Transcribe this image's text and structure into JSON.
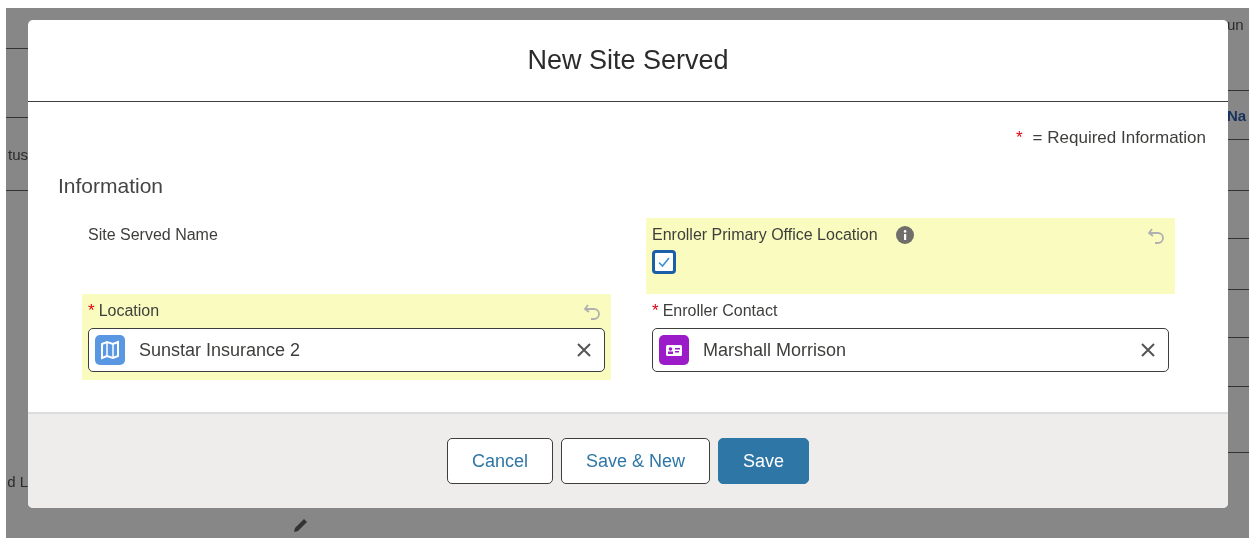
{
  "background": {
    "left_texts": [
      "tus",
      "d L"
    ],
    "right_texts": [
      "un",
      "Na"
    ]
  },
  "modal": {
    "title": "New Site Served",
    "required_mark": "*",
    "required_note": "= Required Information",
    "section": "Information",
    "fields": [
      {
        "kind": "text",
        "label": "Site Served Name",
        "required": false,
        "highlighted": false,
        "undo": false
      },
      {
        "kind": "checkbox",
        "label": "Enroller Primary Office Location",
        "required": false,
        "highlighted": true,
        "undo": true,
        "info": true,
        "checked": true,
        "focused": true
      },
      {
        "kind": "location_lookup",
        "label": "Location",
        "required": true,
        "highlighted": true,
        "undo": true,
        "value": "Sunstar Insurance 2",
        "color": "#5a97e2"
      },
      {
        "kind": "contact_lookup",
        "label": "Enroller Contact",
        "required": true,
        "highlighted": false,
        "undo": false,
        "value": "Marshall Morrison",
        "color": "#9b1bc8"
      }
    ],
    "buttons": [
      {
        "label": "Cancel",
        "primary": false
      },
      {
        "label": "Save & New",
        "primary": false
      },
      {
        "label": "Save",
        "primary": true
      }
    ]
  }
}
